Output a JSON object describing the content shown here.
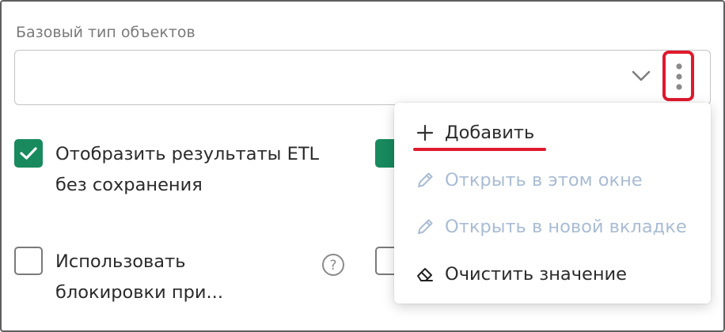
{
  "field": {
    "label": "Базовый тип объектов",
    "value": ""
  },
  "checkboxes": [
    {
      "line1": "Отобразить результаты ETL",
      "line2": "без сохранения",
      "checked": true
    },
    {
      "line1": "Использовать",
      "line2": "блокировки при...",
      "checked": false
    }
  ],
  "context_menu": {
    "items": [
      {
        "label": "Добавить",
        "icon": "plus-icon",
        "enabled": true
      },
      {
        "label": "Открыть в этом окне",
        "icon": "pencil-icon",
        "enabled": false
      },
      {
        "label": "Открыть в новой вкладке",
        "icon": "pencil-icon",
        "enabled": false
      },
      {
        "label": "Очистить значение",
        "icon": "eraser-icon",
        "enabled": true
      }
    ]
  },
  "colors": {
    "accent_green": "#188a5e",
    "highlight_red": "#e0192d",
    "disabled_text": "#a9bcd4"
  }
}
